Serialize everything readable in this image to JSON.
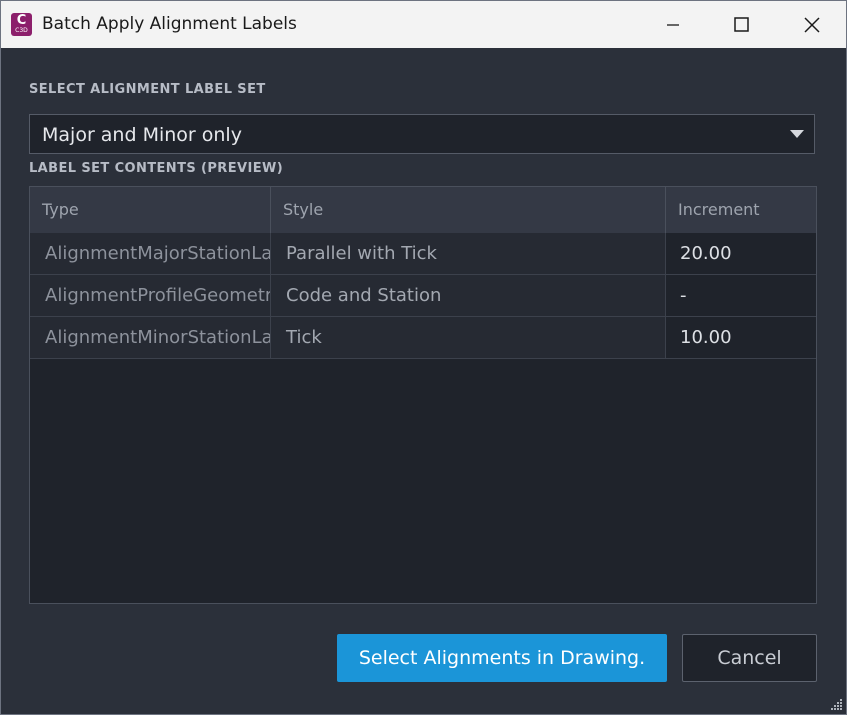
{
  "window": {
    "title": "Batch Apply Alignment Labels",
    "app_icon": {
      "letter": "C",
      "sub": "C3D",
      "color": "#8c1f6b"
    },
    "controls": [
      "minimize-icon",
      "maximize-icon",
      "close-icon"
    ]
  },
  "label_set": {
    "section_label": "SELECT ALIGNMENT LABEL SET",
    "selected": "Major and Minor only"
  },
  "preview": {
    "section_label": "LABEL SET CONTENTS (PREVIEW)",
    "columns": [
      "Type",
      "Style",
      "Increment"
    ],
    "rows": [
      {
        "type": "AlignmentMajorStationLabel",
        "style": "Parallel with Tick",
        "increment": "20.00"
      },
      {
        "type": "AlignmentProfileGeometryPoint",
        "style": "Code and Station",
        "increment": "-"
      },
      {
        "type": "AlignmentMinorStationLabel",
        "style": "Tick",
        "increment": "10.00"
      }
    ]
  },
  "buttons": {
    "select_alignments": "Select Alignments in Drawing.",
    "cancel": "Cancel"
  },
  "colors": {
    "accent": "#1b95d8",
    "background": "#2b303a"
  }
}
